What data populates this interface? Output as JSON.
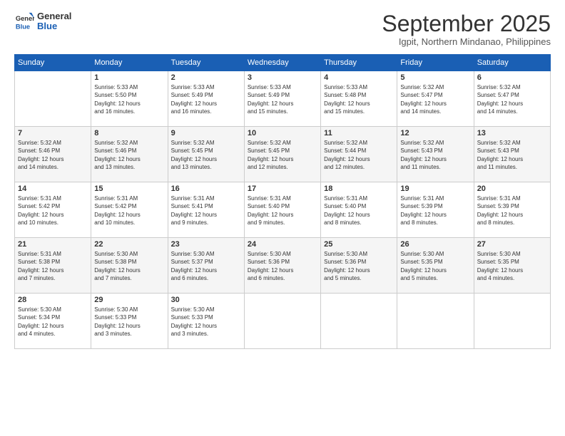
{
  "header": {
    "logo_line1": "General",
    "logo_line2": "Blue",
    "month_title": "September 2025",
    "location": "Igpit, Northern Mindanao, Philippines"
  },
  "days_of_week": [
    "Sunday",
    "Monday",
    "Tuesday",
    "Wednesday",
    "Thursday",
    "Friday",
    "Saturday"
  ],
  "weeks": [
    [
      {
        "day": "",
        "info": ""
      },
      {
        "day": "1",
        "info": "Sunrise: 5:33 AM\nSunset: 5:50 PM\nDaylight: 12 hours\nand 16 minutes."
      },
      {
        "day": "2",
        "info": "Sunrise: 5:33 AM\nSunset: 5:49 PM\nDaylight: 12 hours\nand 16 minutes."
      },
      {
        "day": "3",
        "info": "Sunrise: 5:33 AM\nSunset: 5:49 PM\nDaylight: 12 hours\nand 15 minutes."
      },
      {
        "day": "4",
        "info": "Sunrise: 5:33 AM\nSunset: 5:48 PM\nDaylight: 12 hours\nand 15 minutes."
      },
      {
        "day": "5",
        "info": "Sunrise: 5:32 AM\nSunset: 5:47 PM\nDaylight: 12 hours\nand 14 minutes."
      },
      {
        "day": "6",
        "info": "Sunrise: 5:32 AM\nSunset: 5:47 PM\nDaylight: 12 hours\nand 14 minutes."
      }
    ],
    [
      {
        "day": "7",
        "info": "Sunrise: 5:32 AM\nSunset: 5:46 PM\nDaylight: 12 hours\nand 14 minutes."
      },
      {
        "day": "8",
        "info": "Sunrise: 5:32 AM\nSunset: 5:46 PM\nDaylight: 12 hours\nand 13 minutes."
      },
      {
        "day": "9",
        "info": "Sunrise: 5:32 AM\nSunset: 5:45 PM\nDaylight: 12 hours\nand 13 minutes."
      },
      {
        "day": "10",
        "info": "Sunrise: 5:32 AM\nSunset: 5:45 PM\nDaylight: 12 hours\nand 12 minutes."
      },
      {
        "day": "11",
        "info": "Sunrise: 5:32 AM\nSunset: 5:44 PM\nDaylight: 12 hours\nand 12 minutes."
      },
      {
        "day": "12",
        "info": "Sunrise: 5:32 AM\nSunset: 5:43 PM\nDaylight: 12 hours\nand 11 minutes."
      },
      {
        "day": "13",
        "info": "Sunrise: 5:32 AM\nSunset: 5:43 PM\nDaylight: 12 hours\nand 11 minutes."
      }
    ],
    [
      {
        "day": "14",
        "info": "Sunrise: 5:31 AM\nSunset: 5:42 PM\nDaylight: 12 hours\nand 10 minutes."
      },
      {
        "day": "15",
        "info": "Sunrise: 5:31 AM\nSunset: 5:42 PM\nDaylight: 12 hours\nand 10 minutes."
      },
      {
        "day": "16",
        "info": "Sunrise: 5:31 AM\nSunset: 5:41 PM\nDaylight: 12 hours\nand 9 minutes."
      },
      {
        "day": "17",
        "info": "Sunrise: 5:31 AM\nSunset: 5:40 PM\nDaylight: 12 hours\nand 9 minutes."
      },
      {
        "day": "18",
        "info": "Sunrise: 5:31 AM\nSunset: 5:40 PM\nDaylight: 12 hours\nand 8 minutes."
      },
      {
        "day": "19",
        "info": "Sunrise: 5:31 AM\nSunset: 5:39 PM\nDaylight: 12 hours\nand 8 minutes."
      },
      {
        "day": "20",
        "info": "Sunrise: 5:31 AM\nSunset: 5:39 PM\nDaylight: 12 hours\nand 8 minutes."
      }
    ],
    [
      {
        "day": "21",
        "info": "Sunrise: 5:31 AM\nSunset: 5:38 PM\nDaylight: 12 hours\nand 7 minutes."
      },
      {
        "day": "22",
        "info": "Sunrise: 5:30 AM\nSunset: 5:38 PM\nDaylight: 12 hours\nand 7 minutes."
      },
      {
        "day": "23",
        "info": "Sunrise: 5:30 AM\nSunset: 5:37 PM\nDaylight: 12 hours\nand 6 minutes."
      },
      {
        "day": "24",
        "info": "Sunrise: 5:30 AM\nSunset: 5:36 PM\nDaylight: 12 hours\nand 6 minutes."
      },
      {
        "day": "25",
        "info": "Sunrise: 5:30 AM\nSunset: 5:36 PM\nDaylight: 12 hours\nand 5 minutes."
      },
      {
        "day": "26",
        "info": "Sunrise: 5:30 AM\nSunset: 5:35 PM\nDaylight: 12 hours\nand 5 minutes."
      },
      {
        "day": "27",
        "info": "Sunrise: 5:30 AM\nSunset: 5:35 PM\nDaylight: 12 hours\nand 4 minutes."
      }
    ],
    [
      {
        "day": "28",
        "info": "Sunrise: 5:30 AM\nSunset: 5:34 PM\nDaylight: 12 hours\nand 4 minutes."
      },
      {
        "day": "29",
        "info": "Sunrise: 5:30 AM\nSunset: 5:33 PM\nDaylight: 12 hours\nand 3 minutes."
      },
      {
        "day": "30",
        "info": "Sunrise: 5:30 AM\nSunset: 5:33 PM\nDaylight: 12 hours\nand 3 minutes."
      },
      {
        "day": "",
        "info": ""
      },
      {
        "day": "",
        "info": ""
      },
      {
        "day": "",
        "info": ""
      },
      {
        "day": "",
        "info": ""
      }
    ]
  ]
}
